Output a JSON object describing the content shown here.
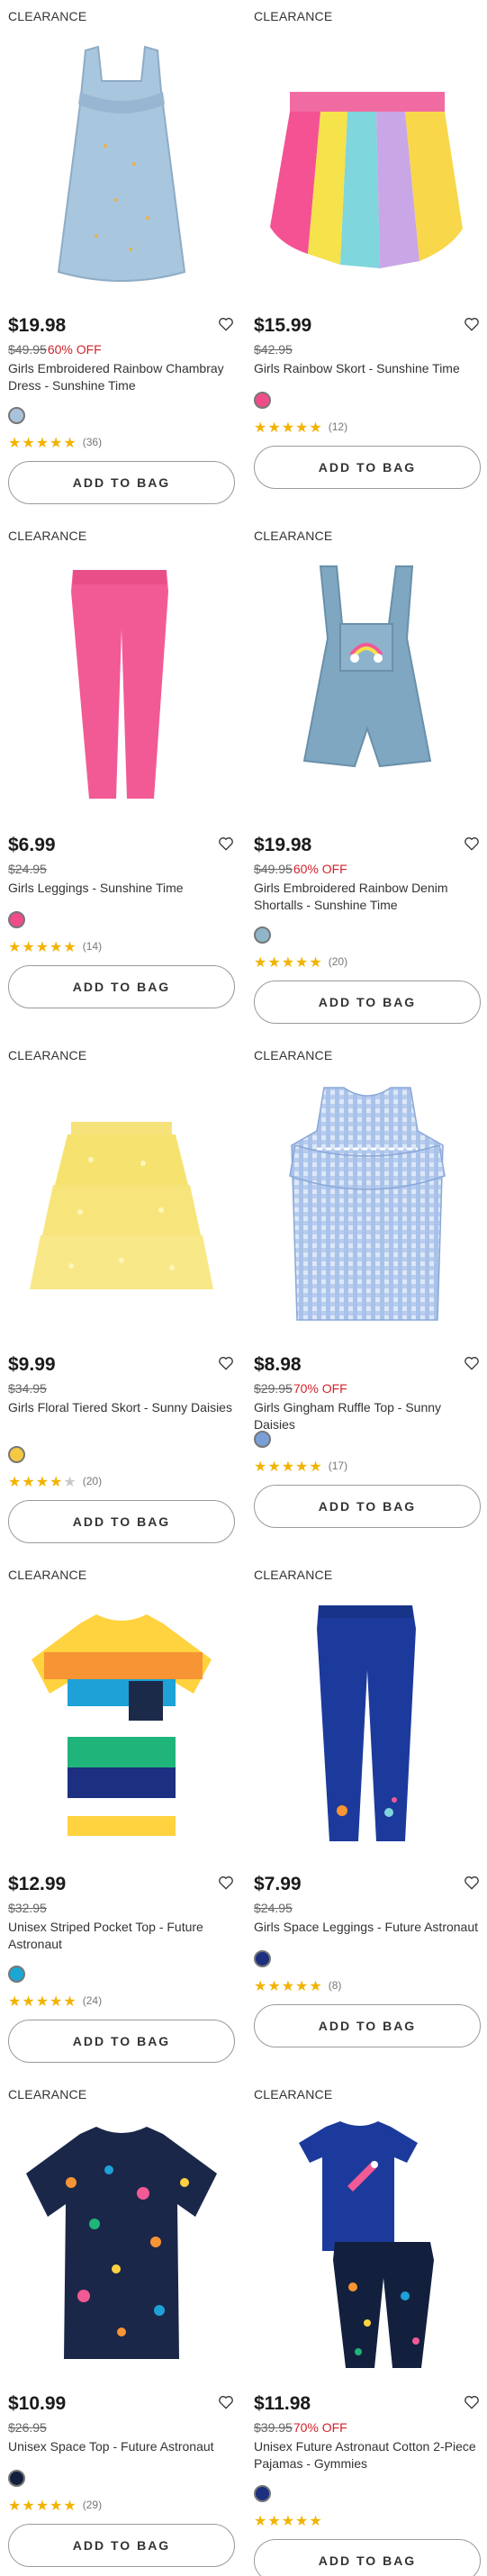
{
  "tag_label": "CLEARANCE",
  "button_label": "ADD TO BAG",
  "products": [
    {
      "price": "$19.98",
      "orig": "$49.95",
      "off": "60% OFF",
      "name": "Girls Embroidered Rainbow Chambray Dress - Sunshine Time",
      "swatch": "#a9c3da",
      "rating": 5,
      "count": "(36)",
      "icon": "chambray-dress"
    },
    {
      "price": "$15.99",
      "orig": "$42.95",
      "off": "",
      "name": "Girls Rainbow Skort - Sunshine Time",
      "swatch": "#ee4d8a",
      "rating": 5,
      "count": "(12)",
      "icon": "rainbow-skort"
    },
    {
      "price": "$6.99",
      "orig": "$24.95",
      "off": "",
      "name": "Girls Leggings - Sunshine Time",
      "swatch": "#ee4d8a",
      "rating": 4.5,
      "count": "(14)",
      "icon": "pink-leggings"
    },
    {
      "price": "$19.98",
      "orig": "$49.95",
      "off": "60% OFF",
      "name": "Girls Embroidered Rainbow Denim Shortalls - Sunshine Time",
      "swatch": "#8fb6c8",
      "rating": 5,
      "count": "(20)",
      "icon": "denim-shortalls"
    },
    {
      "price": "$9.99",
      "orig": "$34.95",
      "off": "",
      "name": "Girls Floral Tiered Skort - Sunny Daisies",
      "swatch": "#f5c842",
      "rating": 4,
      "count": "(20)",
      "icon": "tiered-skort"
    },
    {
      "price": "$8.98",
      "orig": "$29.95",
      "off": "70% OFF",
      "name": "Girls Gingham Ruffle Top - Sunny Daisies",
      "swatch": "#7a9fd6",
      "rating": 5,
      "count": "(17)",
      "icon": "gingham-top"
    },
    {
      "price": "$12.99",
      "orig": "$32.95",
      "off": "",
      "name": "Unisex Striped Pocket Top - Future Astronaut",
      "swatch": "#1aa7d4",
      "rating": 5,
      "count": "(24)",
      "icon": "striped-tee"
    },
    {
      "price": "$7.99",
      "orig": "$24.95",
      "off": "",
      "name": "Girls Space Leggings - Future Astronaut",
      "swatch": "#1c2f80",
      "rating": 5,
      "count": "(8)",
      "icon": "space-leggings"
    },
    {
      "price": "$10.99",
      "orig": "$26.95",
      "off": "",
      "name": "Unisex Space Top - Future Astronaut",
      "swatch": "#13203d",
      "rating": 5,
      "count": "(29)",
      "icon": "space-tee"
    },
    {
      "price": "$11.98",
      "orig": "$39.95",
      "off": "70% OFF",
      "name": "Unisex Future Astronaut Cotton 2-Piece Pajamas - Gymmies",
      "swatch": "#1c2f80",
      "rating": 5,
      "count": "",
      "icon": "astronaut-pajamas"
    }
  ]
}
